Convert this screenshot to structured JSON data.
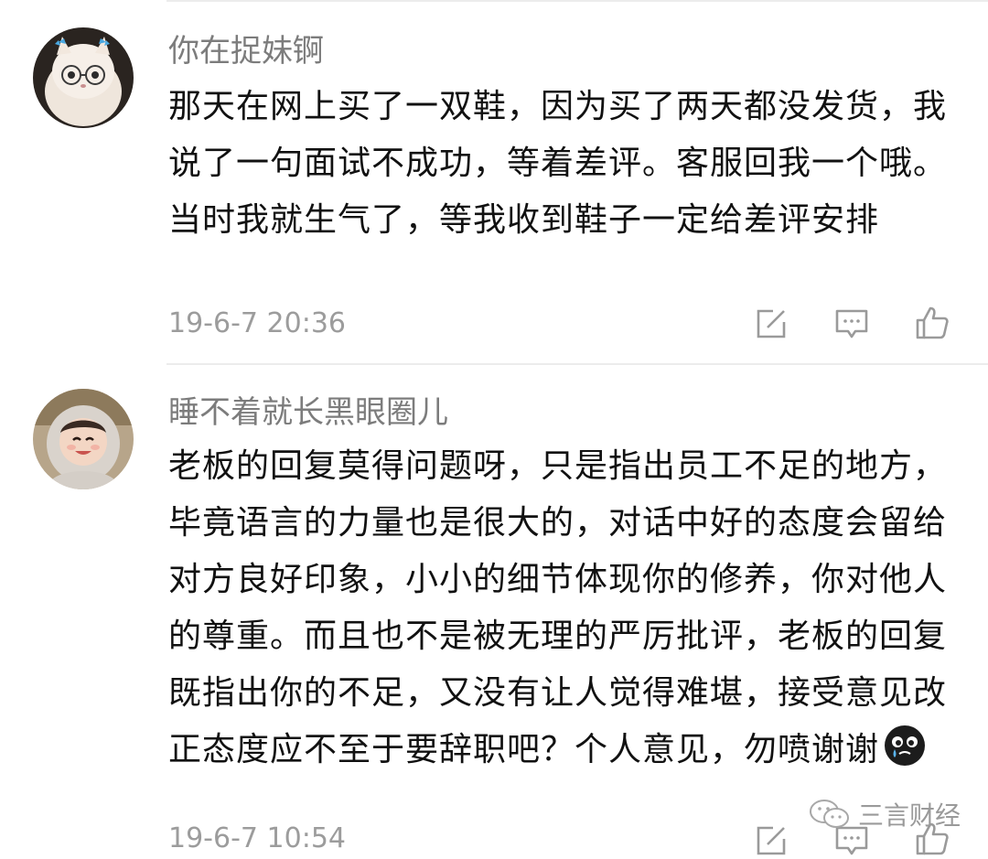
{
  "comments": [
    {
      "username": "你在捉妹锕",
      "text": "那天在网上买了一双鞋，因为买了两天都没发货，我说了一句面试不成功，等着差评。客服回我一个哦。当时我就生气了，等我收到鞋子一定给差评安排",
      "time": "19-6-7 20:36"
    },
    {
      "username": "睡不着就长黑眼圈儿",
      "text": "老板的回复莫得问题呀，只是指出员工不足的地方，毕竟语言的力量也是很大的，对话中好的态度会留给对方良好印象，小小的细节体现你的修养，你对他人的尊重。而且也不是被无理的严厉批评，老板的回复既指出你的不足，又没有让人觉得难堪，接受意见改正态度应不至于要辞职吧？个人意见，勿喷谢谢",
      "time": "19-6-7 10:54"
    }
  ],
  "icons": {
    "share": "share-icon",
    "reply": "reply-icon",
    "like": "like-icon",
    "emoji": "crying-face-icon",
    "watermark": "wechat-icon"
  },
  "watermark": {
    "text": "三言财经"
  },
  "colors": {
    "text": "#111111",
    "meta": "#9c9c9c",
    "username": "#7c7c7c",
    "icon": "#9a9a9a"
  }
}
